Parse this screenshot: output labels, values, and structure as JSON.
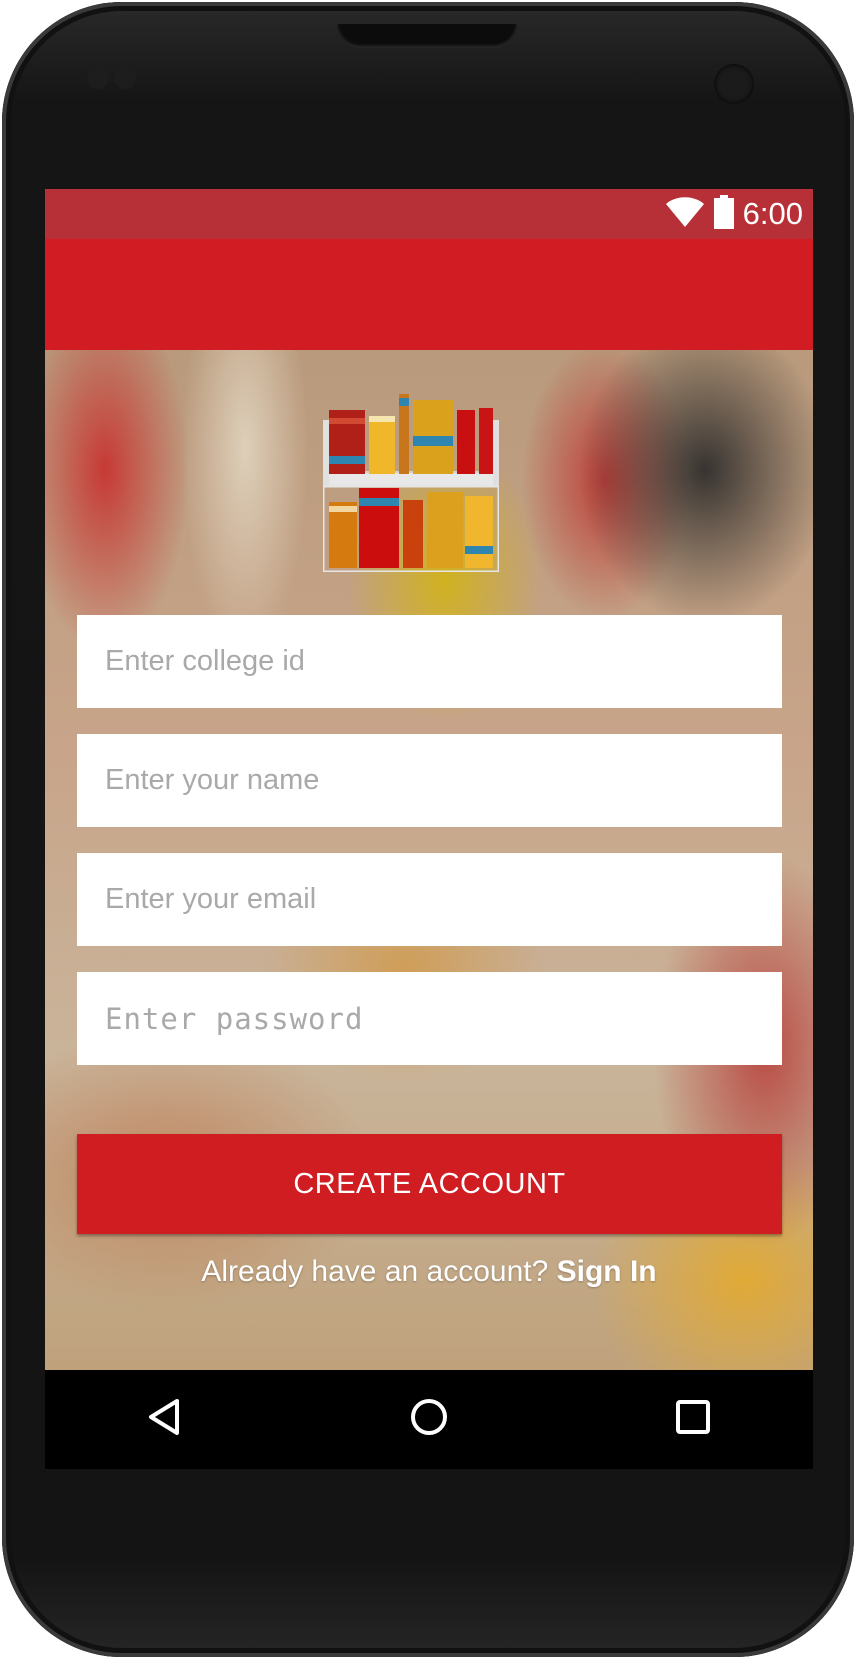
{
  "status_bar": {
    "time": "6:00",
    "icons": [
      "wifi-icon",
      "battery-icon"
    ]
  },
  "app_bar": {
    "title": ""
  },
  "logo": {
    "icon": "bookshelf-icon"
  },
  "form": {
    "college_id": {
      "value": "",
      "placeholder": "Enter college id"
    },
    "name": {
      "value": "",
      "placeholder": "Enter your name"
    },
    "email": {
      "value": "",
      "placeholder": "Enter your email"
    },
    "password": {
      "value": "",
      "placeholder": "Enter password"
    }
  },
  "create_button": {
    "label": "CREATE ACCOUNT"
  },
  "signin": {
    "prompt": "Already have an account?",
    "link": "Sign In"
  },
  "nav": {
    "icons": [
      "back-icon",
      "home-icon",
      "recents-icon"
    ]
  },
  "colors": {
    "primary": "#d01c22",
    "status_bar": "#b83037",
    "nav_bar": "#000000"
  }
}
